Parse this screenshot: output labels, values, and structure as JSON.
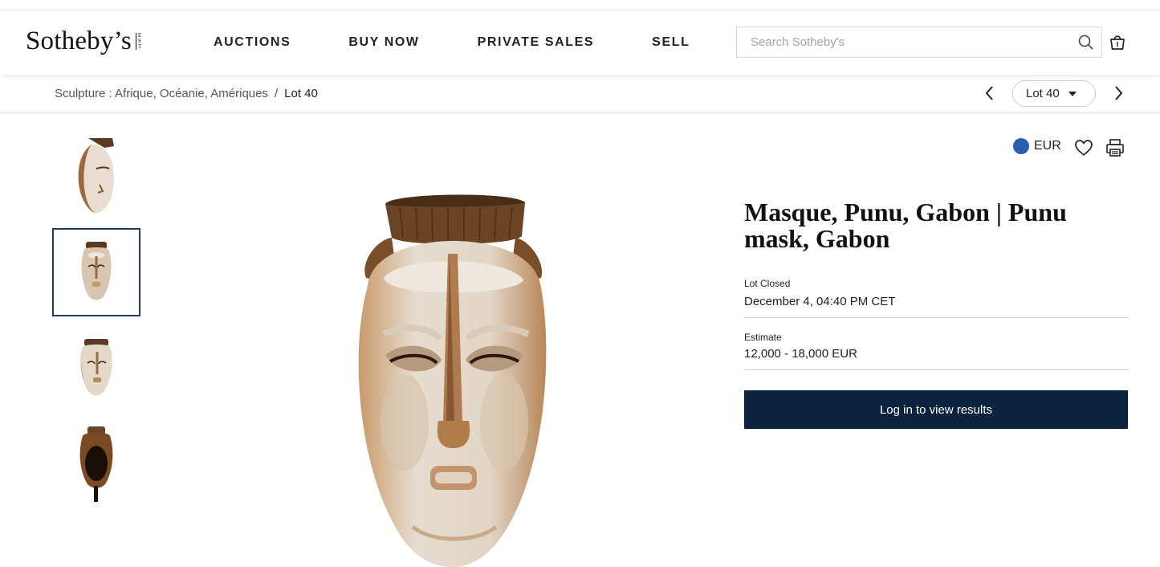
{
  "header": {
    "logo_text": "Sotheby’s",
    "logo_est": [
      "E",
      "S",
      "T",
      "1",
      "7",
      "4",
      "4"
    ],
    "nav": [
      "AUCTIONS",
      "BUY NOW",
      "PRIVATE SALES",
      "SELL"
    ],
    "search_placeholder": "Search Sotheby's",
    "icons": {
      "search": "search-icon",
      "bag": "shopping-bag-icon"
    }
  },
  "breadcrumb": {
    "parent": "Sculpture : Afrique, Océanie, Amériques",
    "separator": "/",
    "current": "Lot 40"
  },
  "lot_nav": {
    "selected_lot": "Lot 40",
    "icons": {
      "prev": "chevron-left-icon",
      "next": "chevron-right-icon",
      "dropdown": "caret-down-icon"
    }
  },
  "gallery": {
    "thumbnails": [
      "mask-side-view",
      "mask-front-view",
      "mask-three-quarter-view",
      "mask-back-view"
    ],
    "selected_index": 1
  },
  "tools": {
    "currency": "EUR",
    "icons": {
      "currency": "globe-icon",
      "favorite": "heart-icon",
      "print": "printer-icon"
    }
  },
  "lot": {
    "title": "Masque, Punu, Gabon | Punu mask, Gabon",
    "status_label": "Lot Closed",
    "status_value": "December 4, 04:40 PM CET",
    "estimate_label": "Estimate",
    "estimate_value": "12,000 - 18,000 EUR",
    "cta": "Log in to view results"
  },
  "colors": {
    "brand_navy": "#0c2340",
    "selected_thumb_border": "#1d3b6b",
    "globe_blue": "#2a5cb0"
  }
}
